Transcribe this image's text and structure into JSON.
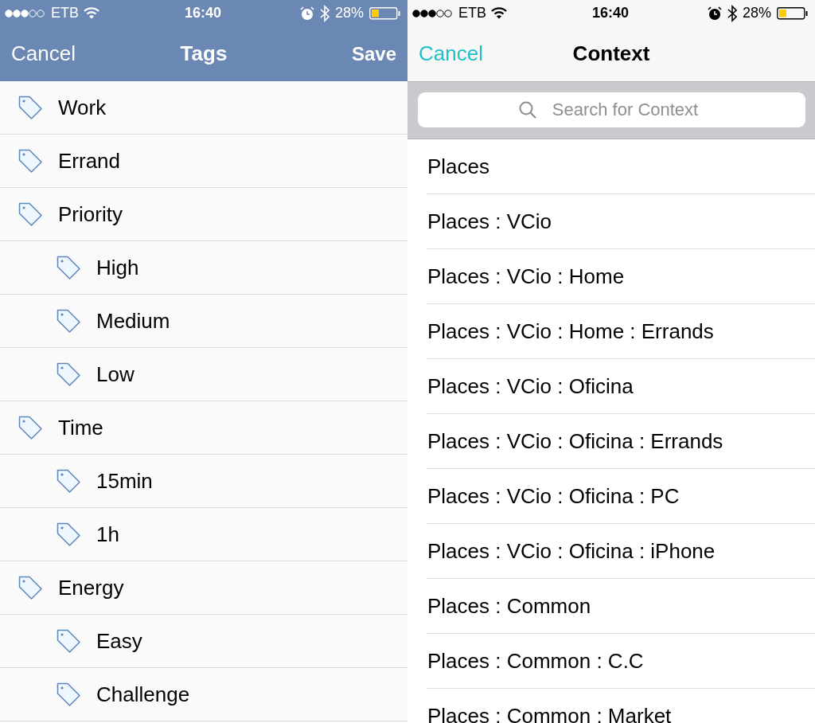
{
  "tags_screen": {
    "status_bar": {
      "carrier": "ETB",
      "time": "16:40",
      "battery": "28%"
    },
    "nav": {
      "cancel": "Cancel",
      "title": "Tags",
      "save": "Save"
    },
    "tags": [
      {
        "label": "Work"
      },
      {
        "label": "Errand"
      },
      {
        "label": "Priority",
        "children": [
          {
            "label": "High"
          },
          {
            "label": "Medium"
          },
          {
            "label": "Low"
          }
        ]
      },
      {
        "label": "Time",
        "children": [
          {
            "label": "15min"
          },
          {
            "label": "1h"
          }
        ]
      },
      {
        "label": "Energy",
        "children": [
          {
            "label": "Easy"
          },
          {
            "label": "Challenge"
          }
        ]
      }
    ]
  },
  "context_screen": {
    "status_bar": {
      "carrier": "ETB",
      "time": "16:40",
      "battery": "28%"
    },
    "nav": {
      "cancel": "Cancel",
      "title": "Context"
    },
    "search": {
      "placeholder": "Search for Context"
    },
    "items": [
      "Places",
      "Places : VCio",
      "Places : VCio : Home",
      "Places : VCio : Home : Errands",
      "Places : VCio : Oficina",
      "Places : VCio : Oficina : Errands",
      "Places : VCio : Oficina : PC",
      "Places : VCio : Oficina : iPhone",
      "Places : Common",
      "Places : Common : C.C",
      "Places : Common : Market"
    ]
  }
}
